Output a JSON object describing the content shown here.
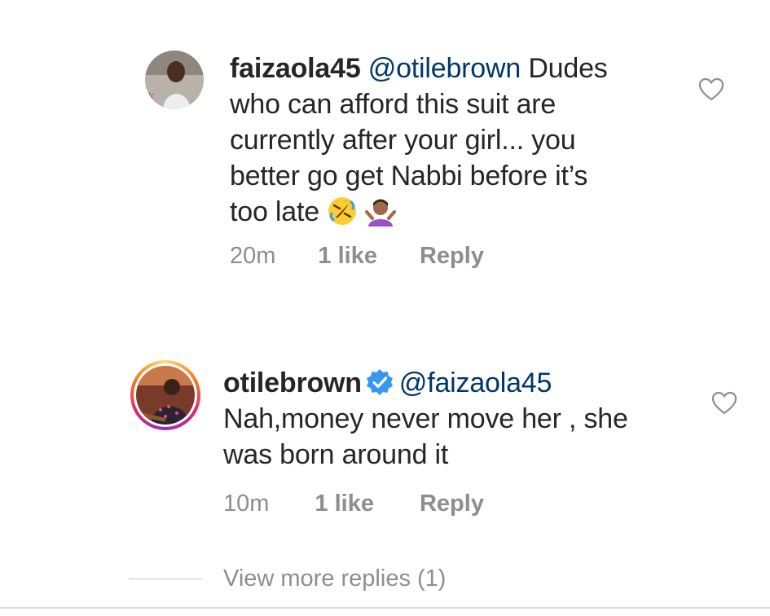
{
  "comments": [
    {
      "username": "faizaola45",
      "mention": "@otilebrown",
      "text_first": "Dudes",
      "text_lines": [
        "who can afford this suit are",
        "currently after your girl... you",
        "better go get Nabbi before it’s"
      ],
      "text_last": "too late",
      "emojis": [
        "rolling-on-floor-laughing",
        "person-shrugging"
      ],
      "time": "20m",
      "likes": "1 like",
      "reply": "Reply",
      "verified": false
    },
    {
      "username": "otilebrown",
      "mention": "@faizaola45",
      "text_lines": [
        "Nah,money never move her , she",
        "was born around it"
      ],
      "time": "10m",
      "likes": "1 like",
      "reply": "Reply",
      "verified": true
    }
  ],
  "view_more": "View more replies (1)",
  "colors": {
    "text": "#262626",
    "mention": "#00376b",
    "meta": "#8e8e8e",
    "verified": "#3897f0"
  }
}
